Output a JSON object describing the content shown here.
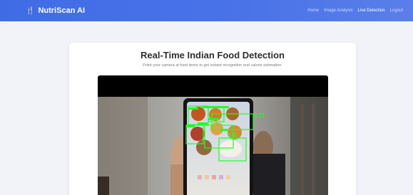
{
  "navbar": {
    "brand": "NutriScan AI",
    "brand_icon": "fork-knife-icon",
    "links": [
      {
        "label": "Home",
        "active": false
      },
      {
        "label": "Image Analysis",
        "active": false
      },
      {
        "label": "Live Detection",
        "active": true
      },
      {
        "label": "Logout",
        "active": false
      }
    ]
  },
  "main": {
    "title": "Real-Time Indian Food Detection",
    "subtitle": "Point your camera at food items to get instant recognition and calorie estimation."
  },
  "camera": {
    "detections": [
      {
        "confidence": "0.71"
      },
      {
        "confidence": "0.92"
      }
    ]
  },
  "colors": {
    "navbar": "#4a73e8",
    "detection_box": "#22ff22",
    "page_bg": "#f1f3f8"
  }
}
